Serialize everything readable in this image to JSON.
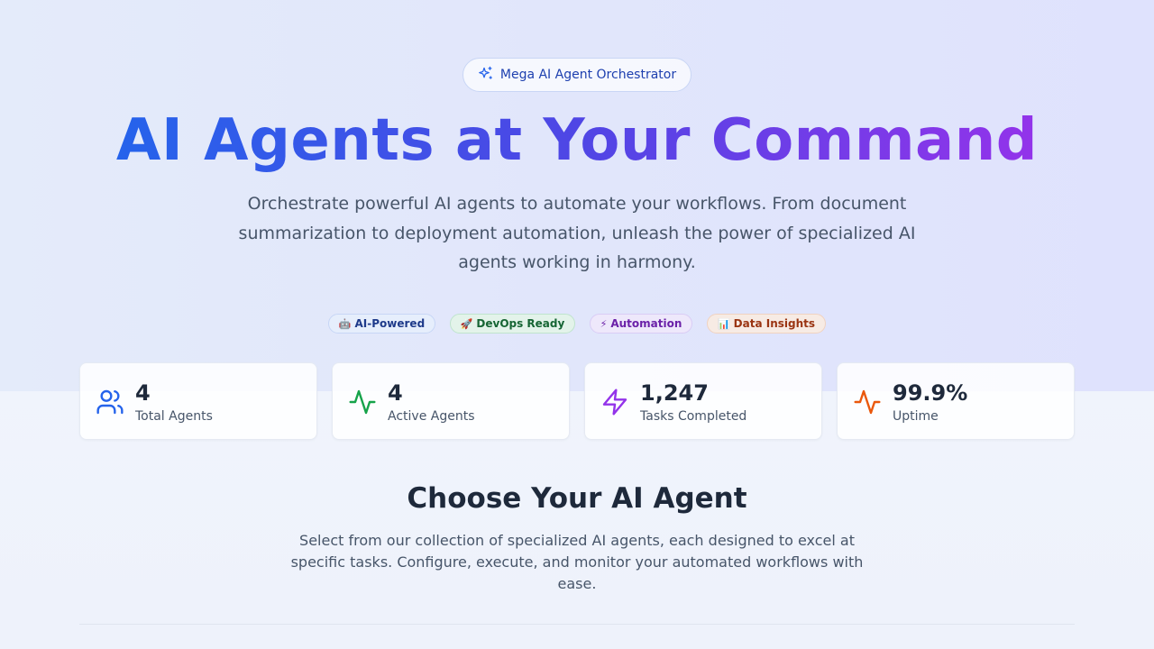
{
  "hero": {
    "badge": "Mega AI Agent Orchestrator",
    "badge_icon": "sparkles-icon",
    "title": "AI Agents at Your Command",
    "description": "Orchestrate powerful AI agents to automate your workflows. From document summarization to deployment automation, unleash the power of specialized AI agents working in harmony.",
    "gradient_colors": [
      "#2563eb",
      "#4f46e5",
      "#9333ea"
    ]
  },
  "tags": [
    {
      "emoji": "🤖",
      "label": "AI-Powered",
      "color": "#1e3a8a"
    },
    {
      "emoji": "🚀",
      "label": "DevOps Ready",
      "color": "#166534"
    },
    {
      "emoji": "⚡",
      "label": "Automation",
      "color": "#6b21a8"
    },
    {
      "emoji": "📊",
      "label": "Data Insights",
      "color": "#9a3412"
    }
  ],
  "stats": [
    {
      "value": "4",
      "label": "Total Agents",
      "icon": "users-icon",
      "color": "#2563eb"
    },
    {
      "value": "4",
      "label": "Active Agents",
      "icon": "activity-icon",
      "color": "#16a34a"
    },
    {
      "value": "1,247",
      "label": "Tasks Completed",
      "icon": "lightning-icon",
      "color": "#9333ea"
    },
    {
      "value": "99.9%",
      "label": "Uptime",
      "icon": "activity-icon",
      "color": "#ea580c"
    }
  ],
  "section": {
    "title": "Choose Your AI Agent",
    "description": "Select from our collection of specialized AI agents, each designed to excel at specific tasks. Configure, execute, and monitor your automated workflows with ease."
  }
}
